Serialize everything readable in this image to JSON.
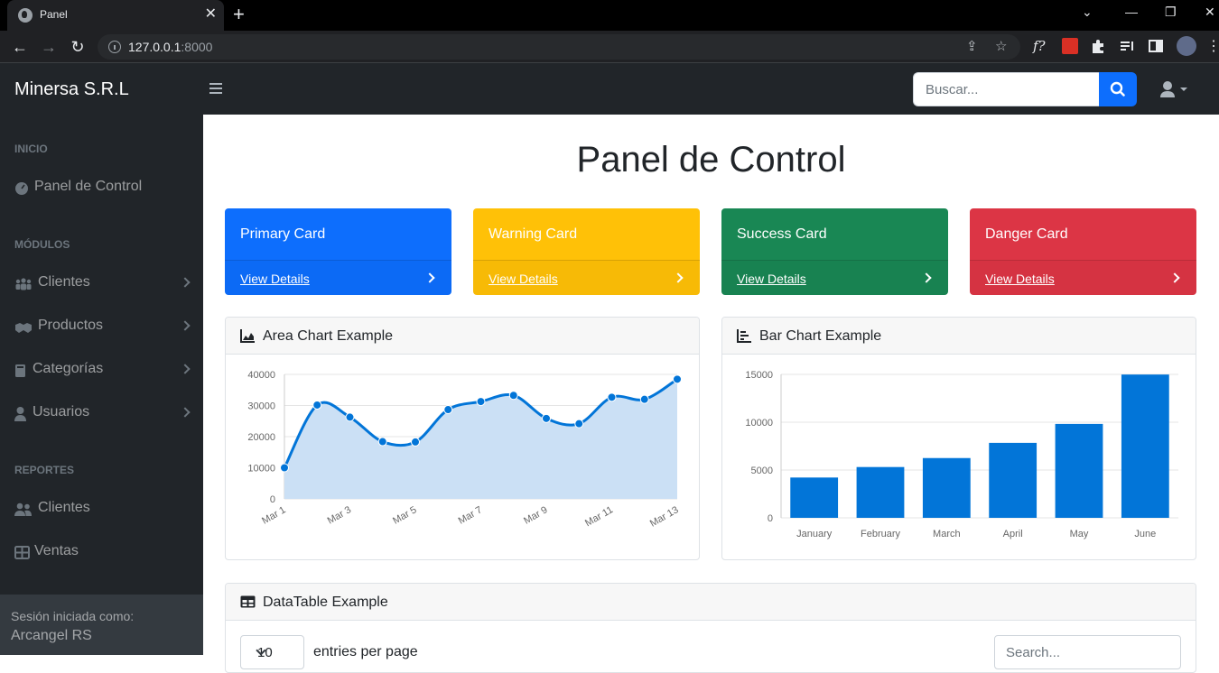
{
  "browser": {
    "tab_title": "Panel",
    "url_host": "127.0.0.1",
    "url_port": ":8000"
  },
  "navbar": {
    "brand": "Minersa S.R.L",
    "search_placeholder": "Buscar...",
    "search_accent": "#0d6efd"
  },
  "sidebar": {
    "sections": [
      {
        "heading": "INICIO",
        "items": [
          {
            "label": "Panel de Control",
            "icon": "gauge-icon",
            "has_submenu": false
          }
        ]
      },
      {
        "heading": "MÓDULOS",
        "items": [
          {
            "label": "Clientes",
            "icon": "users-icon",
            "has_submenu": true
          },
          {
            "label": "Productos",
            "icon": "handshake-icon",
            "has_submenu": true
          },
          {
            "label": "Categorías",
            "icon": "book-icon",
            "has_submenu": true
          },
          {
            "label": "Usuarios",
            "icon": "user-icon",
            "has_submenu": true
          }
        ]
      },
      {
        "heading": "REPORTES",
        "items": [
          {
            "label": "Clientes",
            "icon": "user-group-icon",
            "has_submenu": false
          },
          {
            "label": "Ventas",
            "icon": "table-icon",
            "has_submenu": false
          }
        ]
      }
    ],
    "footer": {
      "label": "Sesión iniciada como:",
      "user": "Arcangel RS"
    }
  },
  "main": {
    "title": "Panel de Control",
    "cards": [
      {
        "title": "Primary Card",
        "link": "View Details",
        "color": "#0d6efd"
      },
      {
        "title": "Warning Card",
        "link": "View Details",
        "color": "#ffc107"
      },
      {
        "title": "Success Card",
        "link": "View Details",
        "color": "#198754"
      },
      {
        "title": "Danger Card",
        "link": "View Details",
        "color": "#dc3545"
      }
    ],
    "area_chart_title": "Area Chart Example",
    "bar_chart_title": "Bar Chart Example",
    "table": {
      "title": "DataTable Example",
      "per_page": "10",
      "per_page_label": "entries per page",
      "search_placeholder": "Search..."
    }
  },
  "chart_data": [
    {
      "type": "area",
      "x": [
        "Mar 1",
        "Mar 2",
        "Mar 3",
        "Mar 4",
        "Mar 5",
        "Mar 6",
        "Mar 7",
        "Mar 8",
        "Mar 9",
        "Mar 10",
        "Mar 11",
        "Mar 12",
        "Mar 13"
      ],
      "xticks": [
        "Mar 1",
        "Mar 3",
        "Mar 5",
        "Mar 7",
        "Mar 9",
        "Mar 11",
        "Mar 13"
      ],
      "values": [
        10000,
        30162,
        26263,
        18394,
        18287,
        28682,
        31274,
        33259,
        25849,
        24159,
        32651,
        31984,
        38451
      ],
      "ylim": [
        0,
        40000
      ],
      "yticks": [
        0,
        10000,
        20000,
        30000,
        40000
      ],
      "grid": true,
      "line_color": "#0275d8",
      "fill_color": "#cbe0f5"
    },
    {
      "type": "bar",
      "categories": [
        "January",
        "February",
        "March",
        "April",
        "May",
        "June"
      ],
      "values": [
        4215,
        5312,
        6251,
        7841,
        9821,
        14984
      ],
      "ylim": [
        0,
        15000
      ],
      "yticks": [
        0,
        5000,
        10000,
        15000
      ],
      "grid": true,
      "bar_color": "#0275d8"
    }
  ]
}
